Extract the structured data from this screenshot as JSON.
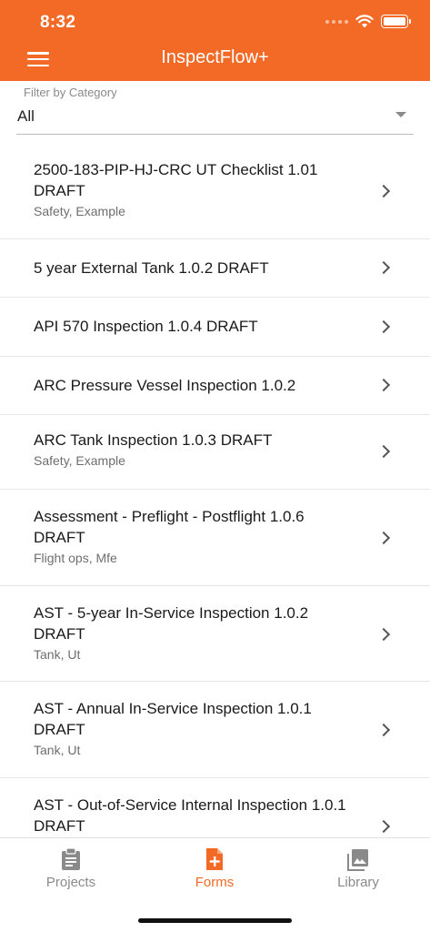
{
  "status_bar": {
    "time": "8:32"
  },
  "header": {
    "title": "InspectFlow+"
  },
  "filter": {
    "label": "Filter by Category",
    "value": "All"
  },
  "forms": [
    {
      "title": "2500-183-PIP-HJ-CRC UT Checklist 1.01 DRAFT",
      "subtitle": "Safety, Example"
    },
    {
      "title": "5 year External Tank 1.0.2 DRAFT",
      "subtitle": ""
    },
    {
      "title": "API 570 Inspection 1.0.4 DRAFT",
      "subtitle": ""
    },
    {
      "title": "ARC Pressure Vessel Inspection 1.0.2",
      "subtitle": ""
    },
    {
      "title": "ARC Tank Inspection 1.0.3 DRAFT",
      "subtitle": "Safety, Example"
    },
    {
      "title": "Assessment - Preflight - Postflight 1.0.6 DRAFT",
      "subtitle": "Flight ops, Mfe"
    },
    {
      "title": "AST - 5-year In-Service Inspection 1.0.2 DRAFT",
      "subtitle": "Tank, Ut"
    },
    {
      "title": "AST - Annual In-Service Inspection 1.0.1 DRAFT",
      "subtitle": "Tank, Ut"
    },
    {
      "title": "AST - Out-of-Service Internal Inspection 1.0.1 DRAFT",
      "subtitle": ""
    }
  ],
  "tabs": [
    {
      "label": "Projects",
      "icon": "clipboard-icon",
      "active": false
    },
    {
      "label": "Forms",
      "icon": "add-document-icon",
      "active": true
    },
    {
      "label": "Library",
      "icon": "photo-library-icon",
      "active": false
    }
  ],
  "colors": {
    "brand": "#f26a25",
    "inactive": "#8a8a8a"
  }
}
